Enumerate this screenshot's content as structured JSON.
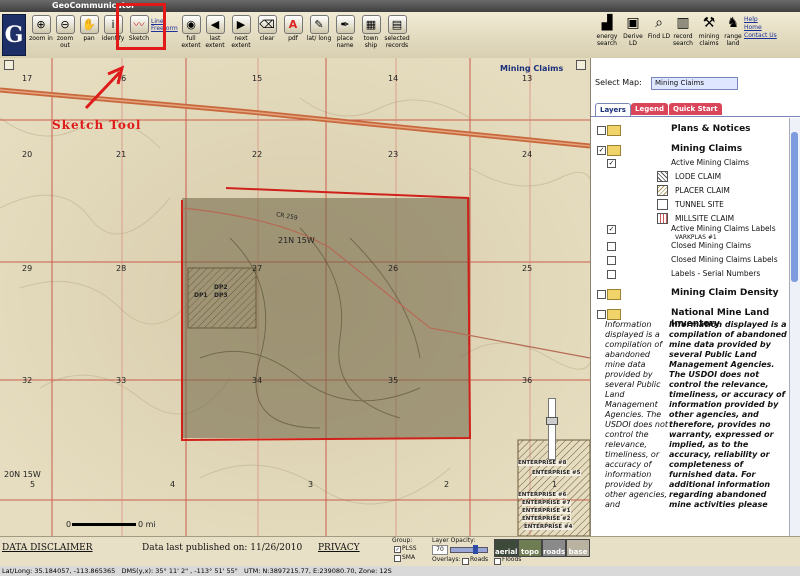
{
  "window": {
    "title": "GeoCommunicator"
  },
  "toolbar": {
    "tools": [
      {
        "label": "zoom in",
        "icon": "zoom-in-icon",
        "glyph": "⊕"
      },
      {
        "label": "zoom out",
        "icon": "zoom-out-icon",
        "glyph": "⊖"
      },
      {
        "label": "pan",
        "icon": "hand-icon",
        "glyph": "✋"
      },
      {
        "label": "identify",
        "icon": "info-icon",
        "glyph": "i"
      },
      {
        "label": "Sketch",
        "icon": "sketch-icon",
        "glyph": "〰"
      },
      {
        "label": "full extent",
        "icon": "globe-icon",
        "glyph": "◉"
      },
      {
        "label": "last extent",
        "icon": "arrow-left-icon",
        "glyph": "◀"
      },
      {
        "label": "next extent",
        "icon": "arrow-right-icon",
        "glyph": "▶"
      },
      {
        "label": "clear",
        "icon": "eraser-icon",
        "glyph": "⌫"
      },
      {
        "label": "pdf",
        "icon": "pdf-icon",
        "glyph": "A"
      },
      {
        "label": "lat/ long",
        "icon": "pencil-icon",
        "glyph": "✎"
      },
      {
        "label": "place name",
        "icon": "marker-icon",
        "glyph": "✒"
      },
      {
        "label": "town ship",
        "icon": "grid-icon",
        "glyph": "▦"
      },
      {
        "label": "selected records",
        "icon": "table-icon",
        "glyph": "▤"
      }
    ],
    "sketch_options": [
      "Line",
      "Freeform"
    ],
    "right_tools": [
      {
        "label": "energy search",
        "icon": "factory-icon",
        "glyph": "▟"
      },
      {
        "label": "Derive LD",
        "icon": "derive-icon",
        "glyph": "▣"
      },
      {
        "label": "Find LD",
        "icon": "find-icon",
        "glyph": "⌕"
      },
      {
        "label": "record search",
        "icon": "record-icon",
        "glyph": "▥"
      },
      {
        "label": "mining claims",
        "icon": "pickaxe-icon",
        "glyph": "⚒"
      },
      {
        "label": "range land",
        "icon": "cow-icon",
        "glyph": "♞"
      }
    ],
    "links": [
      "Help",
      "Home",
      "Contact Us"
    ]
  },
  "annotation": {
    "label": "Sketch Tool"
  },
  "map": {
    "title": "Mining Claims",
    "sections": [
      "17",
      "16",
      "15",
      "14",
      "13",
      "20",
      "21",
      "22",
      "23",
      "24",
      "29",
      "28",
      "27",
      "26",
      "25",
      "32",
      "33",
      "34",
      "35",
      "36",
      "5",
      "4",
      "3",
      "2",
      "1"
    ],
    "township_labels": [
      "21N 15W",
      "20N 15W"
    ],
    "road_label": "CR 259",
    "claims": [
      "DP2",
      "DP1",
      "DP3"
    ],
    "enterprise_labels": [
      "ENTERPRISE #8",
      "ENTERPRISE #5",
      "ENTERPRISE #6",
      "ENTERPRISE #7",
      "ENTERPRISE #1",
      "ENTERPRISE #2",
      "ENTERPRISE #4"
    ],
    "scale": {
      "zero": "0",
      "unit": "0 mi"
    }
  },
  "panel": {
    "select_label": "Select Map:",
    "select_value": "Mining Claims",
    "tabs": [
      "Layers",
      "Legend",
      "Quick Start"
    ],
    "groups": [
      {
        "title": "Plans & Notices"
      },
      {
        "title": "Mining Claims"
      },
      {
        "title": "Mining Claim Density"
      },
      {
        "title": "National Mine Land Inventory"
      }
    ],
    "layers": [
      "Active Mining Claims",
      "LODE CLAIM",
      "PLACER CLAIM",
      "TUNNEL SITE",
      "MILLSITE CLAIM",
      "Active Mining Claims Labels",
      "VARKPLAS #1",
      "Closed Mining Claims",
      "Closed Mining Claims Labels",
      "Labels - Serial Numbers"
    ],
    "info_left": "Information displayed is a compilation of abandoned mine data provided by several Public Land Management Agencies. The USDOI does not control the relevance, timeliness, or accuracy of information provided by other agencies, and",
    "info_right": "Information displayed is a compilation of abandoned mine data provided by several Public Land Management Agencies. The USDOI does not control the relevance, timeliness, or accuracy of information provided by other agencies, and therefore, provides no warranty, expressed or implied, as to the accuracy, reliability or completeness of furnished data. For additional information regarding abandoned mine activities please"
  },
  "footer": {
    "disclaimer": "DATA DISCLAIMER",
    "published": "Data last published on: 11/26/2010",
    "privacy": "PRIVACY",
    "group_label": "Group:",
    "group_options": [
      "PLSS",
      "SMA"
    ],
    "opacity_label": "Layer Opacity:",
    "opacity_value": "70",
    "overlays_label": "Overlays:",
    "overlay_options": [
      "Roads",
      "Floods"
    ],
    "basemaps": [
      "aerial",
      "topo",
      "roads",
      "base"
    ]
  },
  "status": {
    "text": "Lat/Long: 35.184057, -113.865365   DMS(y,x): 35° 11' 2\" , -113° 51' 55\"   UTM: N:3897215.77, E:239080.70, Zone: 12S"
  },
  "colors": {
    "accent_red": "#e01b1b",
    "claim_fill": "#6e6446",
    "road": "#c8683c"
  }
}
